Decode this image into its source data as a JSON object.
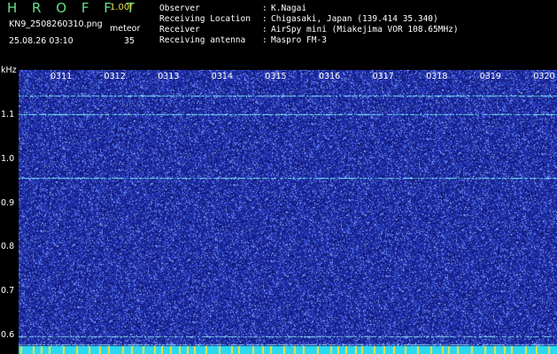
{
  "header": {
    "brand": "H R O F F T",
    "version": "1.00f",
    "filename": "KN9_2508260310.png",
    "unit": "meteor",
    "datetime": "25.08.26 03:10",
    "count": "35",
    "info": [
      {
        "key": "Observer",
        "value": "K.Nagai"
      },
      {
        "key": "Receiving Location",
        "value": "Chigasaki, Japan (139.414 35.340)"
      },
      {
        "key": "Receiver",
        "value": "AirSpy mini (Miakejima VOR 108.65MHz)"
      },
      {
        "key": "Receiving antenna",
        "value": "Maspro FM-3"
      }
    ],
    "separator": ":"
  },
  "axis": {
    "y_unit": "kHz",
    "y_ticks": [
      "1.1",
      "1.0",
      "0.9",
      "0.8",
      "0.7",
      "0.6"
    ],
    "x_ticks": [
      "0311",
      "0312",
      "0313",
      "0314",
      "0315",
      "0316",
      "0317",
      "0318",
      "0319",
      "0320"
    ]
  },
  "chart_data": {
    "type": "heatmap",
    "title": "",
    "x": [
      "0311",
      "0312",
      "0313",
      "0314",
      "0315",
      "0316",
      "0317",
      "0318",
      "0319",
      "0320"
    ],
    "ylabel": "kHz",
    "ylim": [
      0.58,
      1.16
    ],
    "y_ticks": [
      0.6,
      0.7,
      0.8,
      0.9,
      1.0,
      1.1
    ],
    "horizontal_lines_khz": [
      1.107,
      1.069,
      0.94,
      0.617,
      0.6
    ],
    "colors": {
      "background": "#1a2aa0",
      "noise": "#5a78ff",
      "signal": "#7ff0ff",
      "bottom_band": "#2ad8f0"
    }
  }
}
